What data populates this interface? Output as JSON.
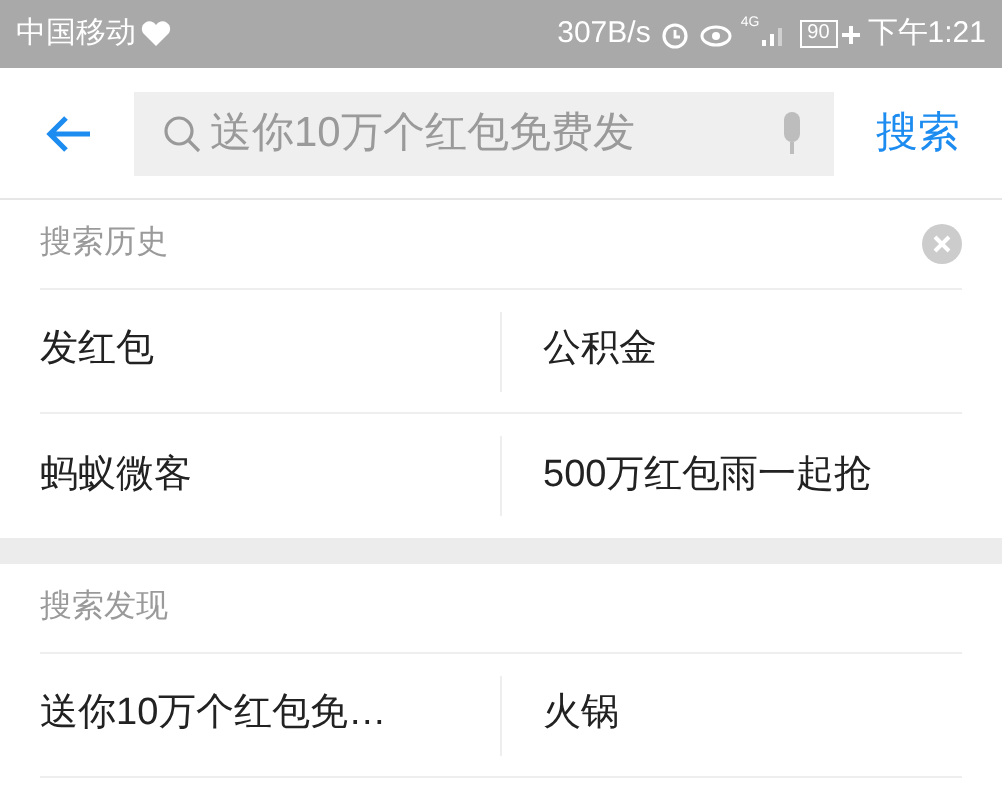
{
  "status_bar": {
    "carrier": "中国移动",
    "speed": "307B/s",
    "network": "4G",
    "battery": "90",
    "time": "下午1:21"
  },
  "search": {
    "placeholder": "送你10万个红包免费发",
    "submit": "搜索"
  },
  "sections": [
    {
      "title": "搜索历史",
      "clearable": true,
      "items": [
        "发红包",
        "公积金",
        "蚂蚁微客",
        "500万红包雨一起抢"
      ]
    },
    {
      "title": "搜索发现",
      "clearable": false,
      "items": [
        "送你10万个红包免…",
        "火锅"
      ]
    }
  ]
}
